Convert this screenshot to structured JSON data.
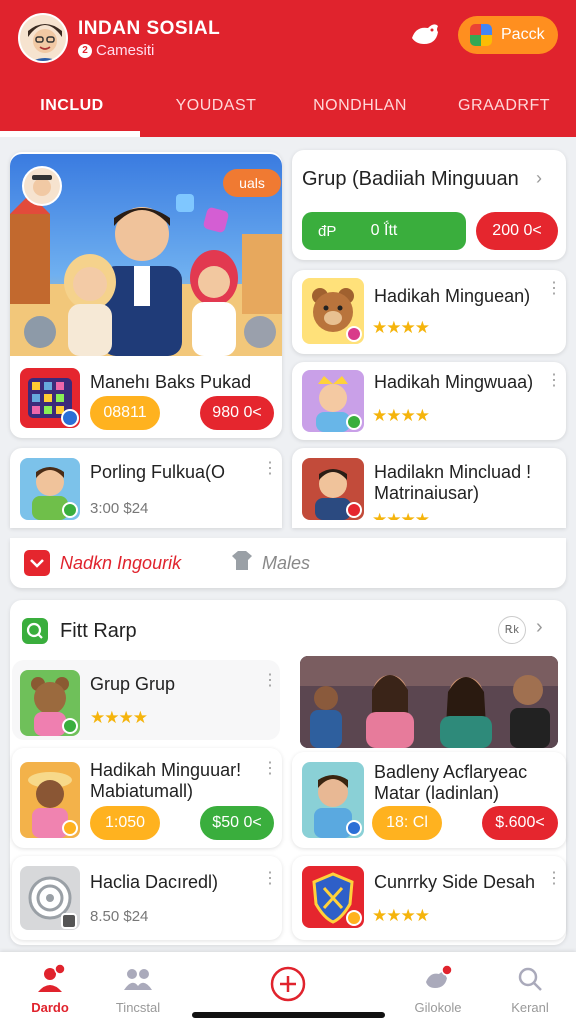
{
  "header": {
    "title": "INDAN SOSIAL",
    "subtitle": "Camesiti",
    "subtitle_prefix": "2",
    "pack_button": "Pacck",
    "avatar_icon": "user-avatar",
    "brand_color": "#e0232d"
  },
  "tabs": [
    {
      "label": "INCLUD",
      "active": true
    },
    {
      "label": "YOUDAST",
      "active": false
    },
    {
      "label": "NONDHLAN",
      "active": false
    },
    {
      "label": "GRAADRFT",
      "active": false
    }
  ],
  "hero": {
    "chip": "uals",
    "card_title": "Manehı Baks Pukad",
    "price_a": "08811",
    "price_b": "980 0<"
  },
  "group_card": {
    "title": "Grup (Badiiah Minguuan",
    "green_button": "0 Ḯtt",
    "green_icon_text": "đP",
    "red_button": "200 0<"
  },
  "right_list": [
    {
      "title": "Hadikah Minguean)"
    },
    {
      "title": "Hadikah Mingwuaa)"
    }
  ],
  "porling_card": {
    "title": "Porling Fulkua(O",
    "meta": "3:00 $24"
  },
  "hadilakn_card": {
    "title_line1": "Hadilakn Mincluad !",
    "title_line2": "Matrinaiusar)"
  },
  "tabbar2": {
    "left": "Nadkn Ingourik",
    "right": "Males"
  },
  "section2": {
    "title": "Fitt Rarp",
    "chip": "Ꭱk",
    "items": {
      "grup_grup": "Grup Grup",
      "hadikah2_line1": "Hadikah Minguuar!",
      "hadikah2_line2": "Mabiatumall)",
      "hadikah2_price_a": "1:050",
      "hadikah2_price_b": "$50 0<",
      "badleny_line1": "Badleny Acflaryeac",
      "badleny_line2": "Matar (ladinlan)",
      "badleny_price_a": "18: Cl",
      "badleny_price_b": "$.600<",
      "haclia": "Haclia Dacıredl)",
      "haclia_meta": "8.50 $24",
      "curkry": "Cunrrky Side Desah"
    }
  },
  "bottom_nav": [
    {
      "label": "Dardo",
      "active": true
    },
    {
      "label": "Tincstal",
      "active": false
    },
    {
      "label": "",
      "active": false
    },
    {
      "label": "Gilokole",
      "active": false
    },
    {
      "label": "Keranl",
      "active": false
    }
  ],
  "icons": [
    "user-avatar",
    "bird-icon",
    "google-icon",
    "chevron-right-icon",
    "kebab-icon",
    "star-icon",
    "add-icon",
    "search-icon"
  ]
}
